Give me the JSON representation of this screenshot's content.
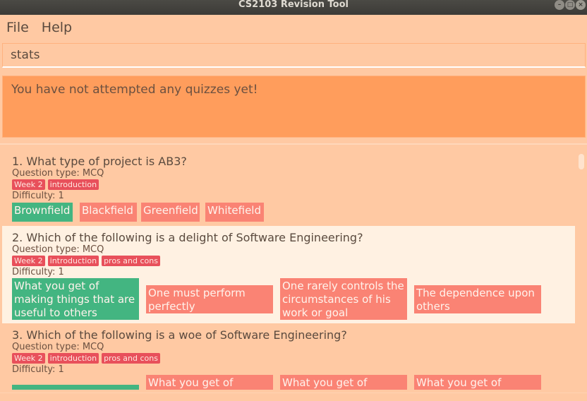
{
  "window": {
    "title": "CS2103 Revision Tool"
  },
  "menu": {
    "file": "File",
    "help": "Help"
  },
  "command": {
    "value": "stats"
  },
  "result": {
    "message": "You have not attempted any quizzes yet!"
  },
  "colors": {
    "correct": "#43b581",
    "wrong": "#fa8374",
    "tag": "#e8505b",
    "result_bg": "#ff9d5c"
  },
  "questions": [
    {
      "title": "1.  What type of project is AB3?",
      "type": "Question type: MCQ",
      "tags": [
        "Week 2",
        "introduction"
      ],
      "difficulty": "Difficulty: 1",
      "options": [
        {
          "text": "Brownfield",
          "correct": true
        },
        {
          "text": "Blackfield",
          "correct": false
        },
        {
          "text": "Greenfield",
          "correct": false
        },
        {
          "text": "Whitefield",
          "correct": false
        }
      ]
    },
    {
      "title": "2.  Which of the following is a delight of Software Engineering?",
      "type": "Question type: MCQ",
      "tags": [
        "Week 2",
        "introduction",
        "pros and cons"
      ],
      "difficulty": "Difficulty: 1",
      "options": [
        {
          "text": "What you get of making things that are useful to others",
          "correct": true
        },
        {
          "text": "One must perform perfectly",
          "correct": false
        },
        {
          "text": "One rarely controls the circumstances of his work or goal",
          "correct": false
        },
        {
          "text": "The dependence upon others",
          "correct": false
        }
      ]
    },
    {
      "title": "3.  Which of the following is a woe of Software Engineering?",
      "type": "Question type: MCQ",
      "tags": [
        "Week 2",
        "introduction",
        "pros and cons"
      ],
      "difficulty": "Difficulty: 1",
      "options": [
        {
          "text": "",
          "correct": true
        },
        {
          "text": "What you get of",
          "correct": false
        },
        {
          "text": "What you get of",
          "correct": false
        },
        {
          "text": "What you get of",
          "correct": false
        }
      ]
    }
  ]
}
